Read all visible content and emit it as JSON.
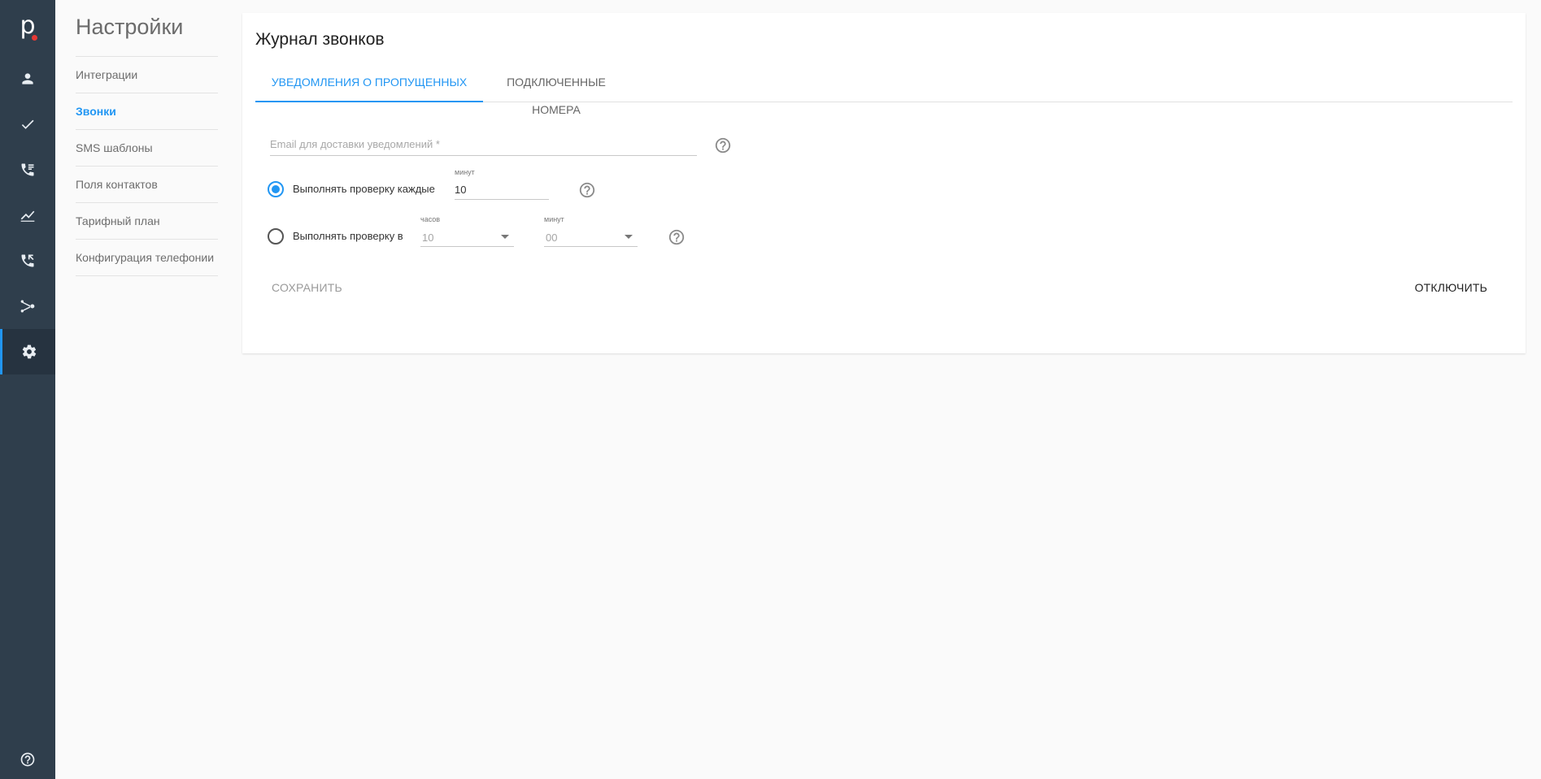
{
  "app": {
    "logo_letter": "p",
    "rail": [
      {
        "name": "contacts",
        "icon": "person-icon"
      },
      {
        "name": "tasks",
        "icon": "check-icon"
      },
      {
        "name": "call-list",
        "icon": "phone-list-icon"
      },
      {
        "name": "analytics",
        "icon": "chart-icon"
      },
      {
        "name": "calls",
        "icon": "phone-callback-icon"
      },
      {
        "name": "integrations",
        "icon": "share-icon"
      },
      {
        "name": "settings",
        "icon": "gear-icon",
        "active": true
      }
    ],
    "help_icon": "help-circle-icon"
  },
  "settings": {
    "title": "Настройки",
    "items": [
      {
        "label": "Интеграции"
      },
      {
        "label": "Звонки",
        "active": true
      },
      {
        "label": "SMS шаблоны"
      },
      {
        "label": "Поля контактов"
      },
      {
        "label": "Тарифный план"
      },
      {
        "label": "Конфигурация телефонии"
      }
    ]
  },
  "card": {
    "title": "Журнал звонков",
    "tabs": [
      {
        "label": "УВЕДОМЛЕНИЯ О ПРОПУЩЕННЫХ",
        "active": true
      },
      {
        "label": "ПОДКЛЮЧЕННЫЕ НОМЕРА"
      }
    ],
    "email": {
      "placeholder": "Email для доставки уведомлений *",
      "value": ""
    },
    "option_every": {
      "label": "Выполнять проверку каждые",
      "field_label": "минут",
      "value": "10",
      "checked": true
    },
    "option_at": {
      "label": "Выполнять проверку в",
      "hours_label": "часов",
      "hours_value": "10",
      "minutes_label": "минут",
      "minutes_value": "00",
      "checked": false
    },
    "save_label": "СОХРАНИТЬ",
    "disable_label": "ОТКЛЮЧИТЬ"
  },
  "colors": {
    "accent": "#2196f3",
    "rail": "#2f3e4c",
    "logo_dot": "#e53935"
  }
}
